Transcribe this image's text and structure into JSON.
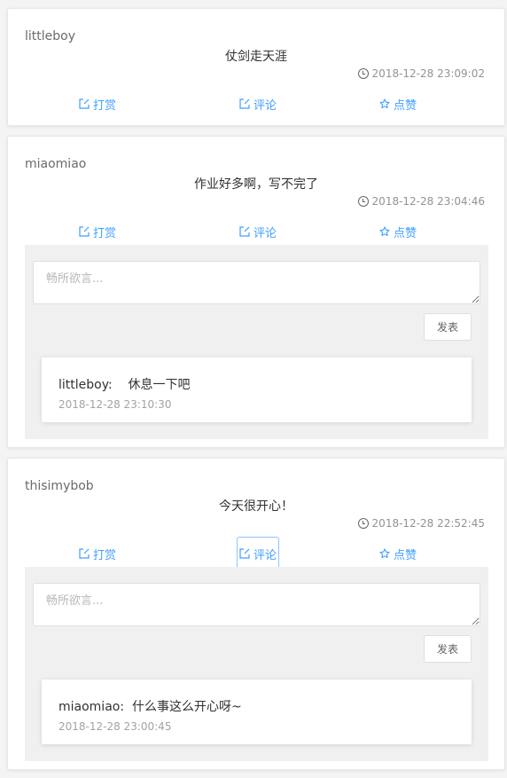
{
  "posts": [
    {
      "author": "littleboy",
      "content": "仗剑走天涯",
      "time": "2018-12-28 23:09:02",
      "actions": {
        "reward": "打赏",
        "comment": "评论",
        "like": "点赞"
      }
    },
    {
      "author": "miaomiao",
      "content": "作业好多啊，写不完了",
      "time": "2018-12-28 23:04:46",
      "actions": {
        "reward": "打赏",
        "comment": "评论",
        "like": "点赞"
      },
      "reply_placeholder": "畅所欲言...",
      "submit_label": "发表",
      "comments": [
        {
          "user": "littleboy:",
          "text": "休息一下吧",
          "time": "2018-12-28 23:10:30"
        }
      ]
    },
    {
      "author": "thisimybob",
      "content": "今天很开心！",
      "time": "2018-12-28 22:52:45",
      "actions": {
        "reward": "打赏",
        "comment": "评论",
        "like": "点赞"
      },
      "reply_placeholder": "畅所欲言...",
      "submit_label": "发表",
      "comments": [
        {
          "user": "miaomiao:",
          "text": "什么事这么开心呀~",
          "time": "2018-12-28 23:00:45"
        }
      ]
    }
  ],
  "colors": {
    "accent": "#409eff",
    "panel": "#f0f0f1"
  }
}
